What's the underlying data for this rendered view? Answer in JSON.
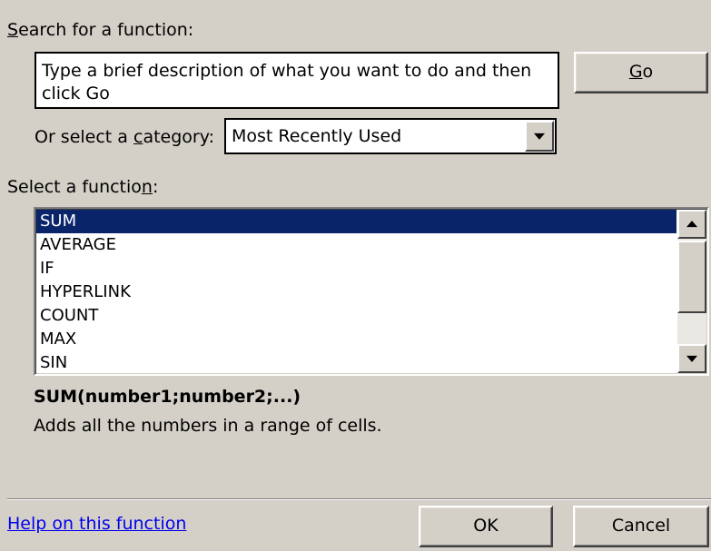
{
  "search": {
    "label_prefix": "",
    "label_underlined": "S",
    "label_rest": "earch for a function:",
    "value": "Type a brief description of what you want to do and then click Go",
    "go_underlined": "G",
    "go_rest": "o"
  },
  "category": {
    "label_pre": "Or select a ",
    "label_underlined": "c",
    "label_post": "ategory:",
    "selected": "Most Recently Used"
  },
  "function_list": {
    "label_pre": "Select a functio",
    "label_underlined": "n",
    "label_post": ":",
    "items": [
      "SUM",
      "AVERAGE",
      "IF",
      "HYPERLINK",
      "COUNT",
      "MAX",
      "SIN"
    ],
    "selected_index": 0
  },
  "details": {
    "signature": "SUM(number1;number2;...)",
    "description": "Adds all the numbers in a range of cells."
  },
  "footer": {
    "help_link": "Help on this function",
    "ok_label": "OK",
    "cancel_label": "Cancel"
  },
  "colors": {
    "dialog_bg": "#d4d0c8",
    "selection_bg": "#0a246a",
    "selection_fg": "#ffffff",
    "link": "#0000ee"
  },
  "icons": {
    "dropdown_arrow": "chevron-down-icon",
    "scroll_up": "scroll-up-arrow-icon",
    "scroll_down": "scroll-down-arrow-icon"
  }
}
